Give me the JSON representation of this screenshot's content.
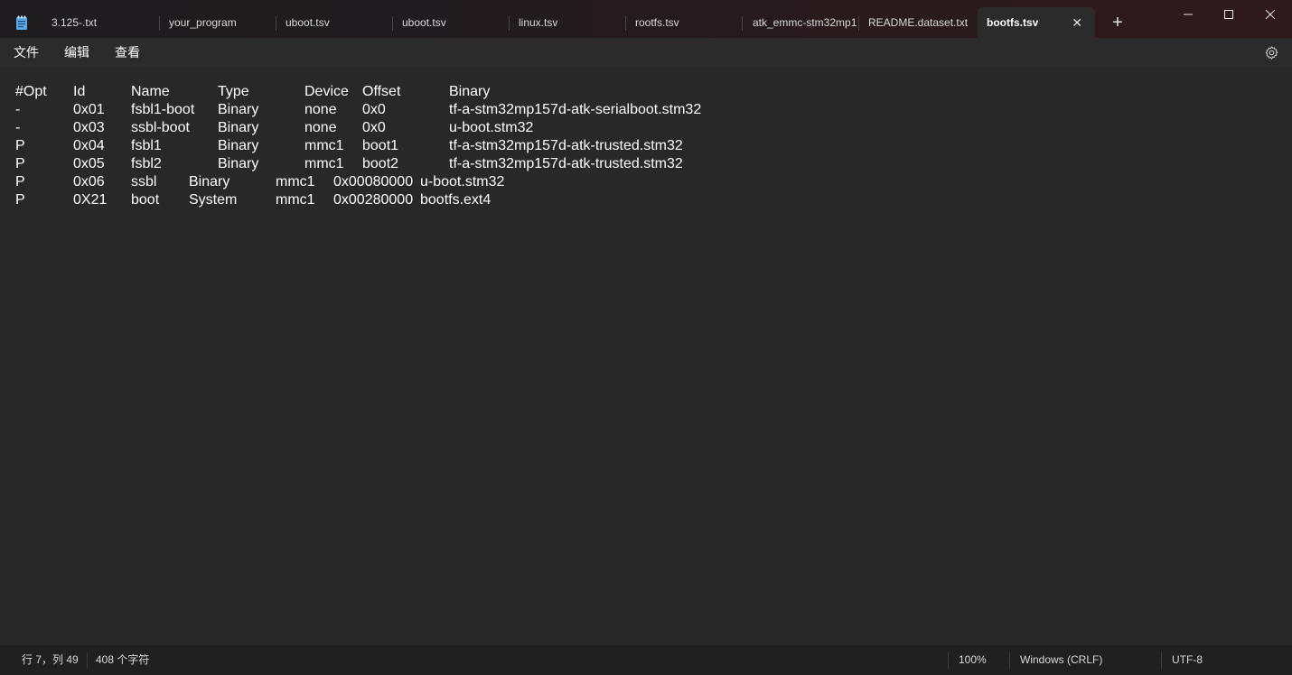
{
  "tabs": [
    {
      "label": "3.125-.txt",
      "active": false
    },
    {
      "label": "your_program",
      "active": false
    },
    {
      "label": "uboot.tsv",
      "active": false
    },
    {
      "label": "uboot.tsv",
      "active": false
    },
    {
      "label": "linux.tsv",
      "active": false
    },
    {
      "label": "rootfs.tsv",
      "active": false
    },
    {
      "label": "atk_emmc-stm32mp1",
      "active": false
    },
    {
      "label": "README.dataset.txt",
      "active": false
    },
    {
      "label": "bootfs.tsv",
      "active": true
    }
  ],
  "tab_close_glyph": "✕",
  "new_tab_glyph": "+",
  "window_controls": {
    "minimize": "—",
    "maximize": "☐",
    "close": "✕"
  },
  "menu": {
    "file": "文件",
    "edit": "编辑",
    "view": "查看"
  },
  "icons": {
    "app": "notepad-icon",
    "settings": "gear-icon"
  },
  "document": {
    "lines": [
      [
        "#Opt",
        "Id",
        "Name",
        "Type",
        "Device",
        "Offset",
        "Binary"
      ],
      [
        "-",
        "0x01",
        "fsbl1-boot",
        "Binary",
        "none",
        "0x0",
        "tf-a-stm32mp157d-atk-serialboot.stm32"
      ],
      [
        "-",
        "0x03",
        "ssbl-boot",
        "Binary",
        "none",
        "0x0",
        "u-boot.stm32"
      ],
      [
        "P",
        "0x04",
        "fsbl1",
        "Binary",
        "mmc1",
        "boot1",
        "tf-a-stm32mp157d-atk-trusted.stm32"
      ],
      [
        "P",
        "0x05",
        "fsbl2",
        "Binary",
        "mmc1",
        "boot2",
        "tf-a-stm32mp157d-atk-trusted.stm32"
      ],
      [
        "P",
        "0x06",
        "ssbl",
        "Binary",
        "mmc1",
        "0x00080000",
        "u-boot.stm32"
      ],
      [
        "P",
        "0X21",
        "boot",
        "System",
        "mmc1",
        "0x00280000",
        "bootfs.ext4"
      ]
    ]
  },
  "status": {
    "position": "行 7，列 49",
    "char_count": "408 个字符",
    "zoom": "100%",
    "line_ending": "Windows (CRLF)",
    "encoding": "UTF-8"
  },
  "colors": {
    "editor_bg": "#282828",
    "chrome_bg": "#202020",
    "menubar_bg": "#2b2b2b",
    "text": "#ffffff"
  }
}
